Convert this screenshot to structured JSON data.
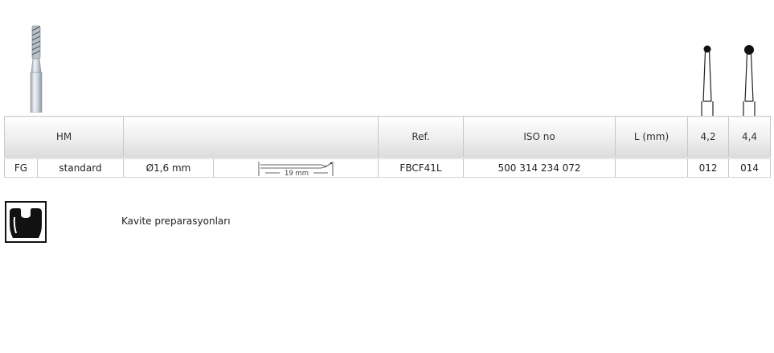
{
  "header": {
    "material": "HM",
    "ref_label": "Ref.",
    "iso_label": "ISO no",
    "length_label": "L (mm)",
    "size_1": "4,2",
    "size_2": "4,4"
  },
  "row": {
    "shank": "FG",
    "length_type": "standard",
    "diameter": "Ø1,6 mm",
    "length_drawing_label": "19 mm",
    "ref": "FBCF41L",
    "iso": "500 314 234 072",
    "length_value": "",
    "code_1": "012",
    "code_2": "014"
  },
  "indication": {
    "text": "Kavite preparasyonları",
    "icon": "cavity-preparation-icon"
  }
}
